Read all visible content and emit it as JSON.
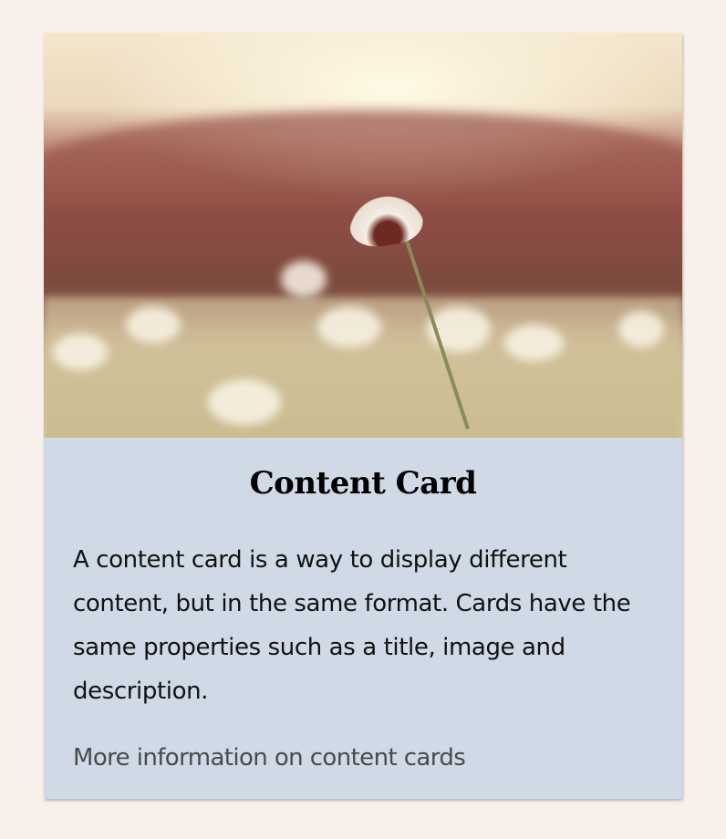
{
  "card": {
    "image": {
      "icon": "daisy-field-photo"
    },
    "title": "Content Card",
    "description": "A content card is a way to display different content, but in the same format. Cards have the same properties such as a title, image and description.",
    "link": "More information on content cards"
  },
  "colors": {
    "background": "#f8f0eb",
    "card": "#cfdae6",
    "link": "#4a4a4a"
  }
}
